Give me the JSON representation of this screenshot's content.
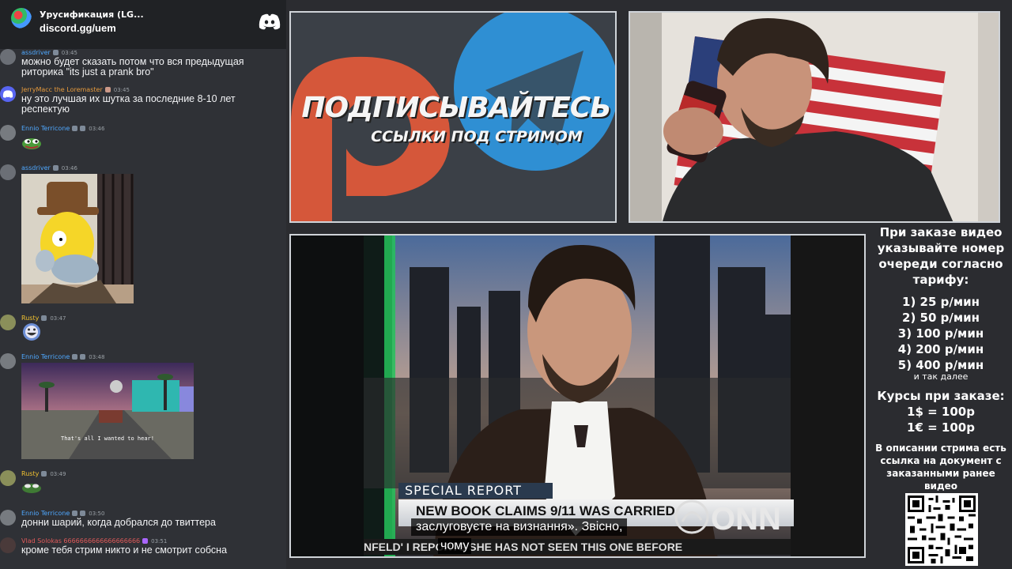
{
  "server": {
    "name": "Урусификация (LG...",
    "link": "discord.gg/uem"
  },
  "messages": [
    {
      "user": "assdriver",
      "time": "03:45",
      "color": "#4fa8ff",
      "text": "можно будет сказать потом что вся предыдущая риторика \"its just a prank bro\""
    },
    {
      "user": "JerryMacc the Loremaster",
      "time": "03:45",
      "color": "#e69a3c",
      "text": "ну это лучшая их шутка за последние 8-10 лет респектую"
    },
    {
      "user": "Ennio Terricone",
      "time": "03:46",
      "color": "#4fa8ff",
      "text": ""
    },
    {
      "user": "assdriver",
      "time": "03:46",
      "color": "#4fa8ff",
      "text": ""
    },
    {
      "user": "Rusty",
      "time": "03:47",
      "color": "#f2c230",
      "text": ""
    },
    {
      "user": "Ennio Terricone",
      "time": "03:48",
      "color": "#4fa8ff",
      "text": ""
    },
    {
      "user": "Rusty",
      "time": "03:49",
      "color": "#f2c230",
      "text": ""
    },
    {
      "user": "Ennio Terricone",
      "time": "03:50",
      "color": "#4fa8ff",
      "text": "донни шарий, когда добрался до твиттера"
    },
    {
      "user": "Vlad Solokas 6666666666666666666",
      "time": "03:51",
      "color": "#e05a5a",
      "text": "кроме тебя стрим никто и не смотрит собсна"
    }
  ],
  "gif_caption": "That's all I wanted to hear!",
  "promo": {
    "title": "ПОДПИСЫВАЙТЕСЬ",
    "subtitle": "ССЫЛКИ ПОД СТРИМОМ"
  },
  "video": {
    "special_report": "SPECIAL REPORT",
    "headline": "NEW BOOK CLAIMS 9/11 WAS CARRIED",
    "subtitle_line1": "заслуговуєте на визнання». Звісно,",
    "subtitle_line2": "чому",
    "ticker": "NFELD' I      REPORTS SHE HAS NOT SEEN THIS ONE BEFORE",
    "logo": "ONN"
  },
  "info": {
    "order_text": "При заказе видео указывайте номер очереди согласно тарифу:",
    "tariffs": [
      "1) 25 р/мин",
      "2) 50 р/мин",
      "3) 100 р/мин",
      "4) 200 р/мин",
      "5) 400 р/мин"
    ],
    "and_so_on": "и так далее",
    "rates_title": "Курсы при заказе:",
    "rate_usd": "1$ = 100р",
    "rate_eur": "1€ = 100р",
    "description": "В описании стрима есть ссылка на документ с заказанными ранее видео"
  }
}
